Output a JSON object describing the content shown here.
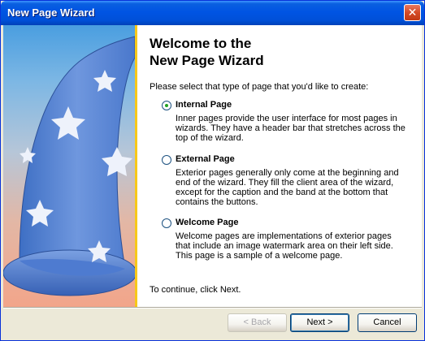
{
  "window": {
    "title": "New Page Wizard",
    "close_label": "✕"
  },
  "page": {
    "heading_line1": "Welcome to the",
    "heading_line2": "New Page Wizard",
    "prompt": "Please select that type of page that you'd like to create:",
    "options": [
      {
        "label": "Internal Page",
        "selected": true,
        "description": "Inner pages provide the user interface for most pages in wizards.  They have a header bar that stretches across the top of the wizard."
      },
      {
        "label": "External Page",
        "selected": false,
        "description": "Exterior pages generally only come at the beginning and end of the wizard.  They fill the client area of the wizard, except for the caption and the band at the bottom that contains the buttons."
      },
      {
        "label": "Welcome Page",
        "selected": false,
        "description": "Welcome pages are implementations of exterior pages that include an image watermark area on their left side.  This page is a sample of a welcome page."
      }
    ],
    "continue_text": "To continue, click Next."
  },
  "buttons": {
    "back": "< Back",
    "next": "Next >",
    "cancel": "Cancel"
  },
  "colors": {
    "title_bar": "#0054e3",
    "band": "#f7c81a",
    "hat": "#5b86d6",
    "hat_brim": "#3f6ec7"
  }
}
